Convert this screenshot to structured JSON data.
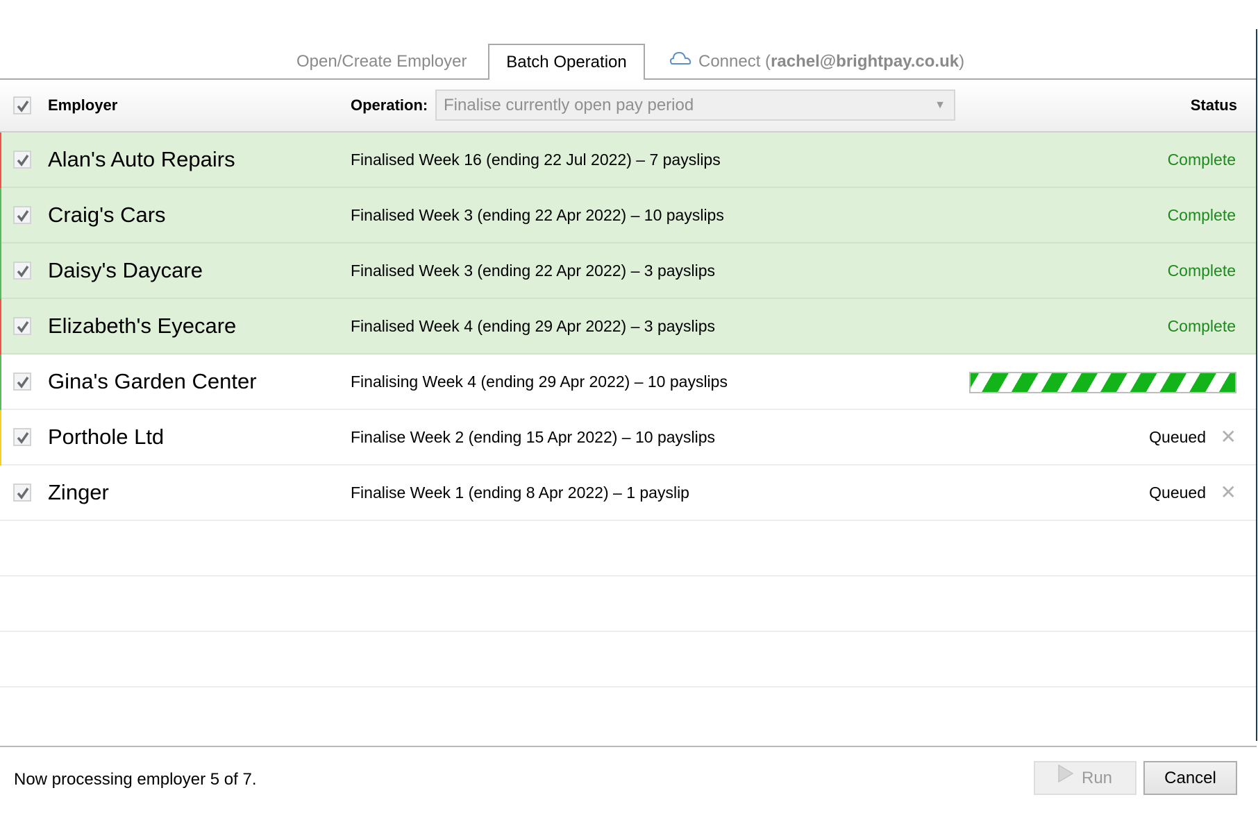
{
  "tabs": {
    "open_create": "Open/Create Employer",
    "batch": "Batch Operation",
    "connect_prefix": "Connect (",
    "connect_email": "rachel@brightpay.co.uk",
    "connect_suffix": ")",
    "active": "Batch Operation"
  },
  "header": {
    "select_all_checked": true,
    "employer_label": "Employer",
    "operation_label": "Operation:",
    "operation_value": "Finalise currently open pay period",
    "status_label": "Status"
  },
  "colors": {
    "complete_text": "#1d8a1d",
    "complete_row_bg": "#dff0d8",
    "progress_stripe": "#13b31a",
    "strip_red": "#e8554a",
    "strip_green": "#5cb85c",
    "strip_yellow": "#f0d020"
  },
  "rows": [
    {
      "checked": true,
      "name": "Alan's Auto Repairs",
      "operation": "Finalised Week 16 (ending 22 Jul 2022) – 7 payslips",
      "status": "Complete",
      "state": "complete",
      "strip": "red"
    },
    {
      "checked": true,
      "name": "Craig's Cars",
      "operation": "Finalised Week 3 (ending 22 Apr 2022) – 10 payslips",
      "status": "Complete",
      "state": "complete",
      "strip": "green"
    },
    {
      "checked": true,
      "name": "Daisy's Daycare",
      "operation": "Finalised Week 3 (ending 22 Apr 2022) – 3 payslips",
      "status": "Complete",
      "state": "complete",
      "strip": "green"
    },
    {
      "checked": true,
      "name": "Elizabeth's Eyecare",
      "operation": "Finalised Week 4 (ending 29 Apr 2022) – 3 payslips",
      "status": "Complete",
      "state": "complete",
      "strip": "red"
    },
    {
      "checked": true,
      "name": "Gina's Garden Center",
      "operation": "Finalising Week 4 (ending 29 Apr 2022) – 10 payslips",
      "status": "",
      "state": "processing",
      "strip": "green"
    },
    {
      "checked": true,
      "name": "Porthole Ltd",
      "operation": "Finalise Week 2 (ending 15 Apr 2022) – 10 payslips",
      "status": "Queued",
      "state": "queued",
      "strip": "yellow"
    },
    {
      "checked": true,
      "name": "Zinger",
      "operation": "Finalise Week 1 (ending 8 Apr 2022) – 1 payslip",
      "status": "Queued",
      "state": "queued",
      "strip": "none"
    }
  ],
  "icons": {
    "checkbox": "checkmark-icon",
    "cloud": "cloud-icon",
    "remove": "close-icon",
    "dropdown": "chevron-down-icon",
    "run": "play-icon",
    "remove_glyph": "✕",
    "dropdown_glyph": "▼"
  },
  "footer": {
    "message": "Now processing employer 5 of 7.",
    "run_label": "Run",
    "run_enabled": false,
    "cancel_label": "Cancel"
  }
}
